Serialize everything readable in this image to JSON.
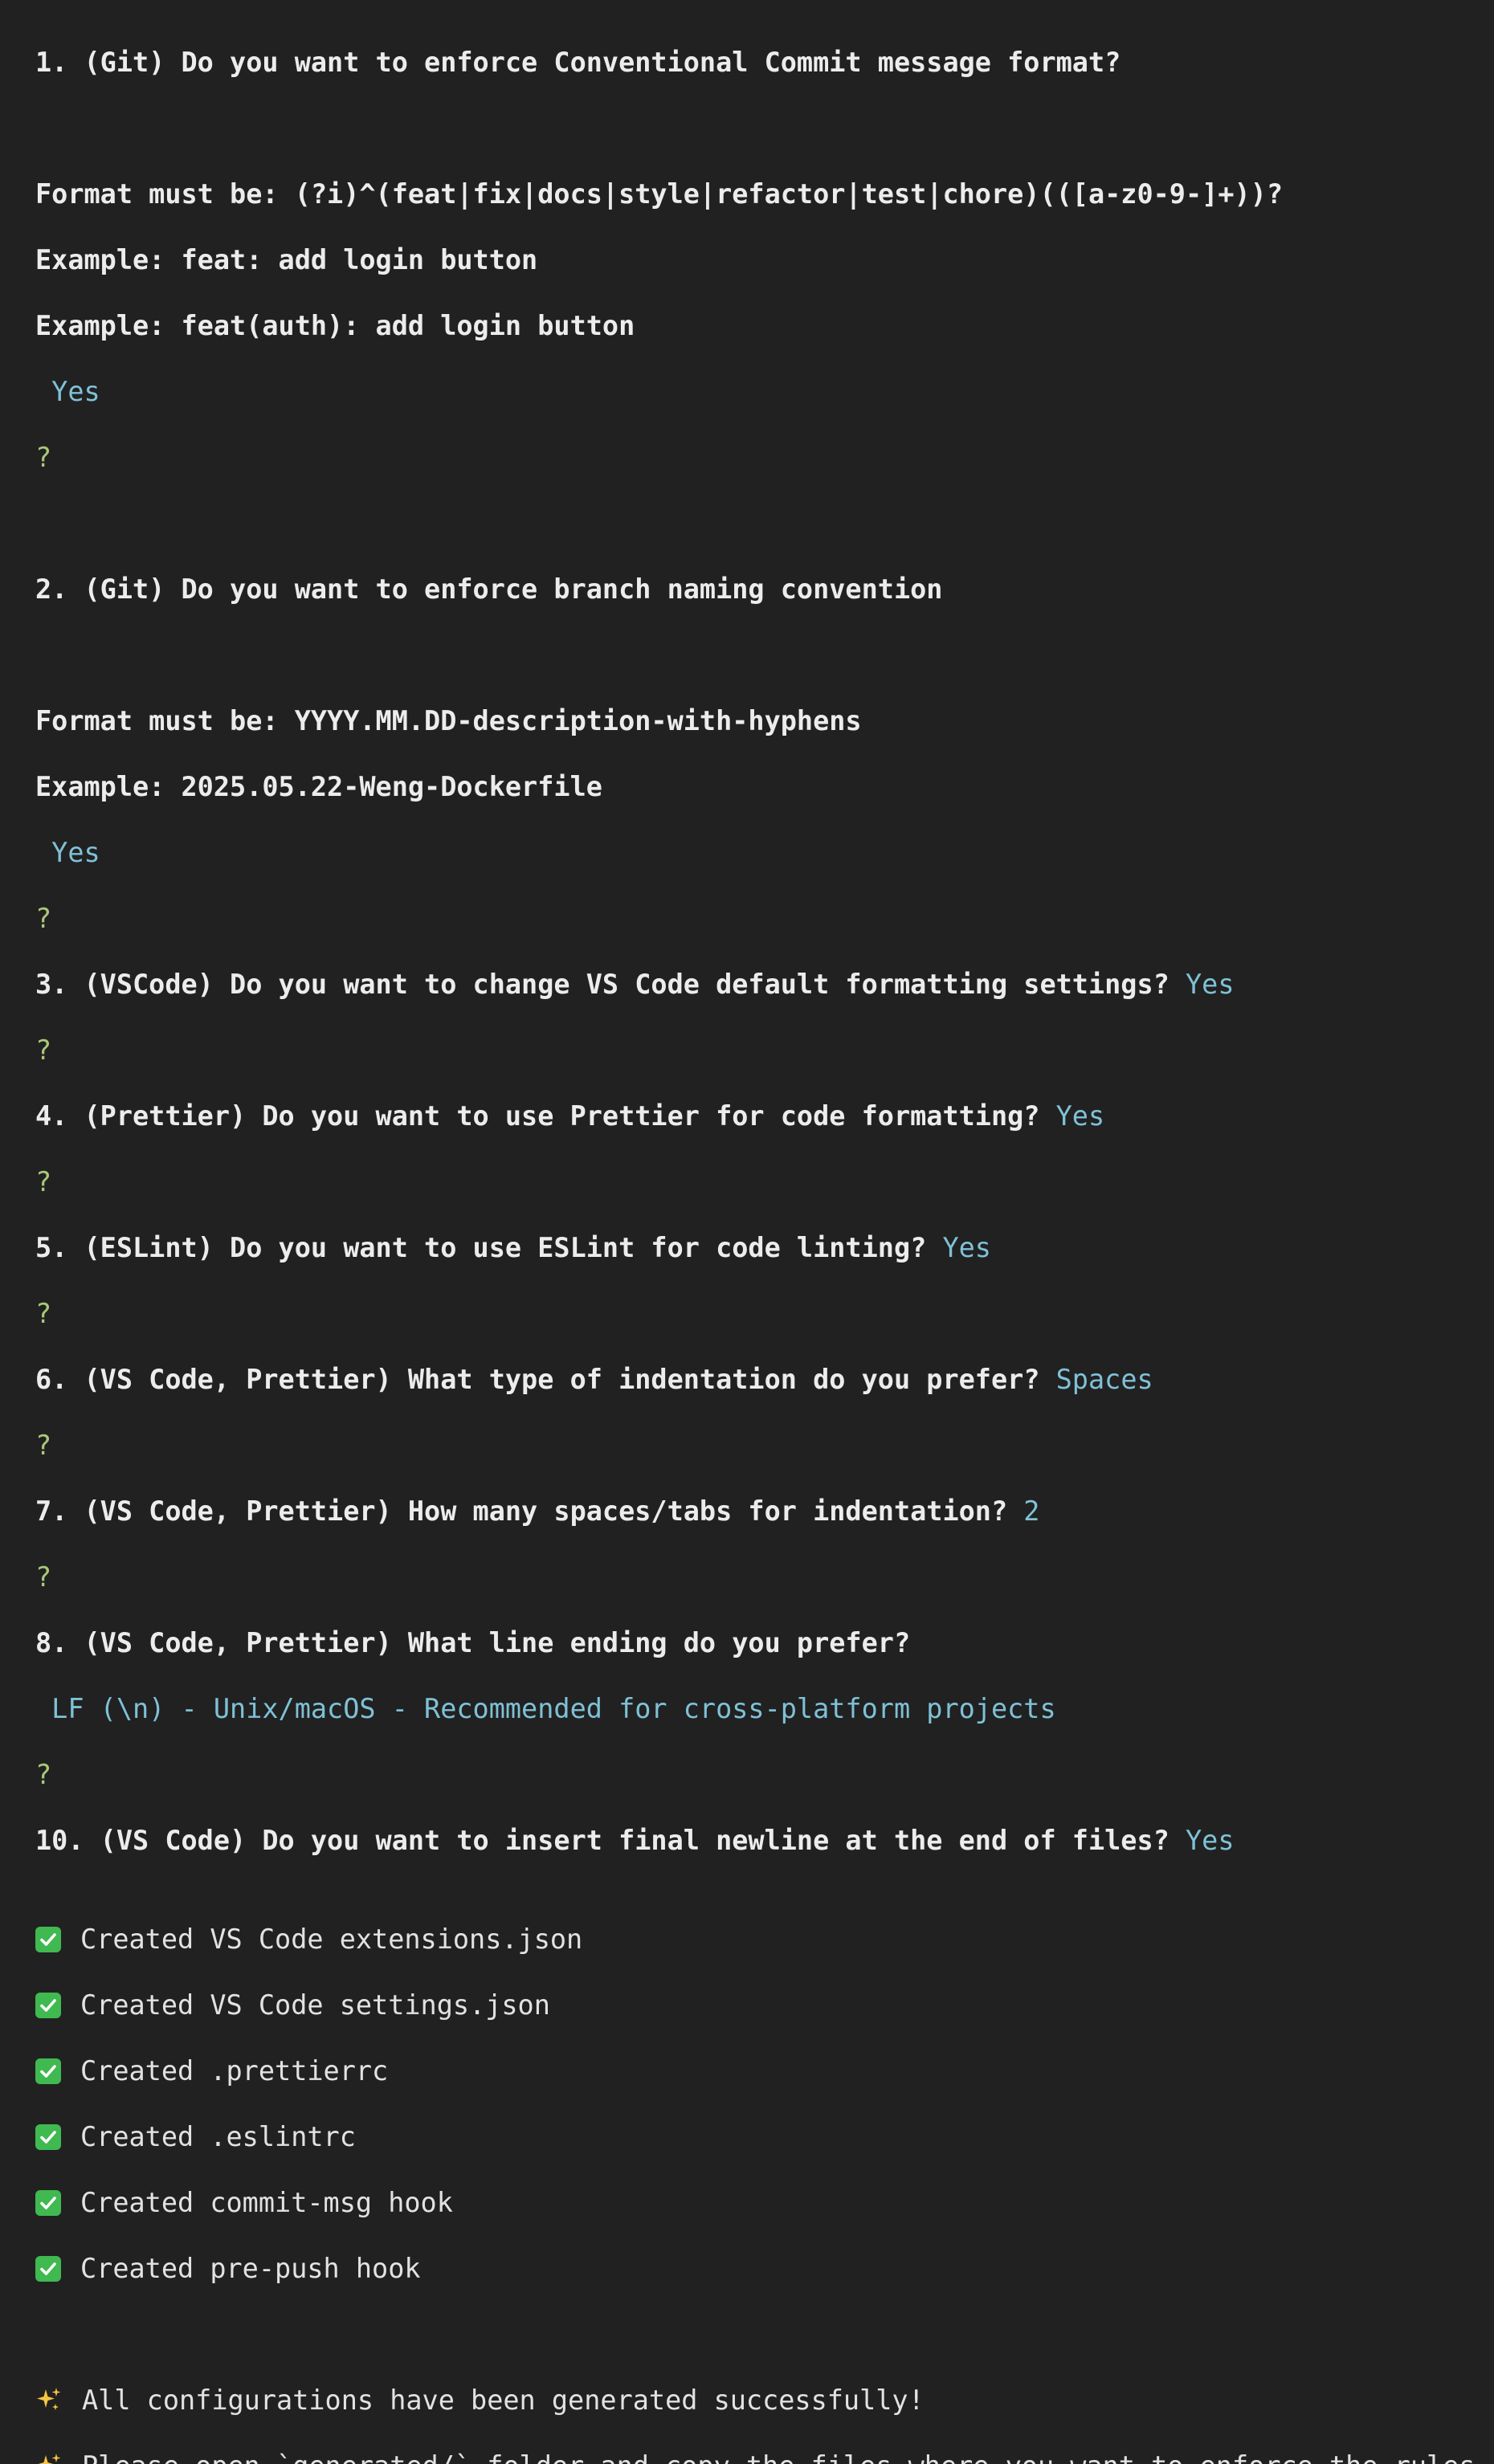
{
  "q1": {
    "title": "1. (Git) Do you want to enforce Conventional Commit message format?",
    "format": "Format must be: (?i)^(feat|fix|docs|style|refactor|test|chore)(([a-z0-9-]+))?",
    "example1": "Example: feat: add login button",
    "example2": "Example: feat(auth): add login button",
    "answer": " Yes"
  },
  "prompt_mark": "?",
  "q2": {
    "title": "2. (Git) Do you want to enforce branch naming convention",
    "format": "Format must be: YYYY.MM.DD-description-with-hyphens",
    "example": "Example: 2025.05.22-Weng-Dockerfile",
    "answer": " Yes"
  },
  "q3": {
    "title": "3. (VSCode) Do you want to change VS Code default formatting settings? ",
    "answer": "Yes"
  },
  "q4": {
    "title": "4. (Prettier) Do you want to use Prettier for code formatting? ",
    "answer": "Yes"
  },
  "q5": {
    "title": "5. (ESLint) Do you want to use ESLint for code linting? ",
    "answer": "Yes"
  },
  "q6": {
    "title": "6. (VS Code, Prettier) What type of indentation do you prefer? ",
    "answer": "Spaces"
  },
  "q7": {
    "title": "7. (VS Code, Prettier) How many spaces/tabs for indentation? ",
    "answer": "2"
  },
  "q8": {
    "title": "8. (VS Code, Prettier) What line ending do you prefer?",
    "answer": " LF (\\n) - Unix/macOS - Recommended for cross-platform projects"
  },
  "q10": {
    "title": "10. (VS Code) Do you want to insert final newline at the end of files? ",
    "answer": "Yes"
  },
  "created": [
    "Created VS Code extensions.json",
    "Created VS Code settings.json",
    "Created .prettierrc",
    "Created .eslintrc",
    "Created commit-msg hook",
    "Created pre-push hook"
  ],
  "done": [
    "All configurations have been generated successfully!",
    "Please open `generated/` folder and copy the files where you want to enforce the rules."
  ],
  "colors": {
    "background": "#212121",
    "answer": "#7fc1d6",
    "prompt_mark": "#a9c87a",
    "check": "#3fb950",
    "sparkle": "#f5c542"
  }
}
